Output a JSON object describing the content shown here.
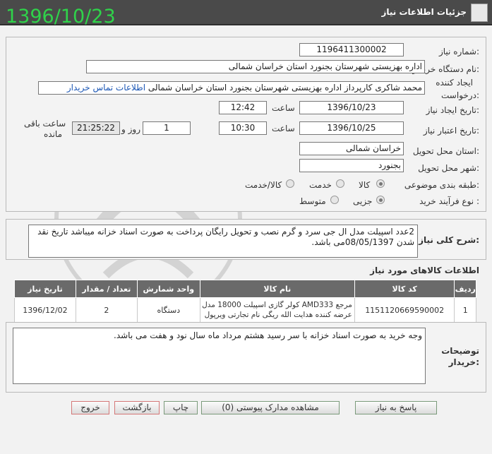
{
  "header": {
    "title": "جزئیات اطلاعات نیاز",
    "overlay_date": "1396/10/23"
  },
  "form": {
    "need_number_label": "شماره نیاز:",
    "need_number": "1196411300002",
    "buyer_org_label": "نام دستگاه خریدار:",
    "buyer_org": "اداره بهزیستی شهرستان بجنورد استان خراسان شمالی",
    "requester_label_1": "ایجاد کننده",
    "requester_label_2": "درخواست:",
    "requester": "محمد شاکری کارپرداز اداره بهزیستی شهرستان بجنورد استان خراسان شمالی",
    "buyer_contact_link": "اطلاعات تماس خریدار",
    "created_label": "تاریخ ایجاد نیاز:",
    "created_date": "1396/10/23",
    "time_label": "ساعت",
    "created_time": "12:42",
    "validity_label": "تاریخ اعتبار نیاز:",
    "validity_date": "1396/10/25",
    "validity_time": "10:30",
    "days": "1",
    "day_and_label": "روز و",
    "remaining_time": "21:25:22",
    "remaining_label_1": "ساعت باقی",
    "remaining_label_2": "مانده",
    "province_label": "استان محل تحویل:",
    "province": "خراسان شمالی",
    "city_label": "شهر محل تحویل:",
    "city": "بجنورد",
    "category_label": "طبقه بندی موضوعی:",
    "category_options": [
      "کالا",
      "خدمت",
      "کالا/خدمت"
    ],
    "process_label": "نوع فرآیند خرید :",
    "process_options": [
      "جزیی",
      "متوسط"
    ]
  },
  "description": {
    "label": "شرح کلی نیاز:",
    "line1": "2عدد اسپیلت مدل ال جی سرد و گرم نصب و تحویل رایگان پرداخت به صورت اسناد خزانه میباشد تاریخ نقد",
    "line2": "شدن 08/05/1397می باشد."
  },
  "items_section": {
    "title": "اطلاعات کالاهای مورد نیاز",
    "columns": [
      "ردیف",
      "کد کالا",
      "نام کالا",
      "واحد شمارش",
      "تعداد / مقدار",
      "تاریخ نیاز"
    ],
    "rows": [
      {
        "row": "1",
        "code": "1151120669590002",
        "name_line1": "کولر گازی اسپیلت 18000 مدل AMD333 مرجع",
        "name_line2": "عرضه کننده هدایت الله ریگی نام تجارتی ویرپول",
        "unit": "دستگاه",
        "qty": "2",
        "date": "1396/12/02"
      }
    ]
  },
  "notes": {
    "label_1": "توضیحات",
    "label_2": "خریدار:",
    "text": "وجه خرید به صورت اسناد خزانه با سر رسید هشتم مرداد ماه سال نود و هفت می باشد."
  },
  "buttons": {
    "reply": "پاسخ به نیاز",
    "attachments": "مشاهده مدارک پیوستی (0)",
    "print": "چاپ",
    "back": "بازگشت",
    "exit": "خروج"
  }
}
